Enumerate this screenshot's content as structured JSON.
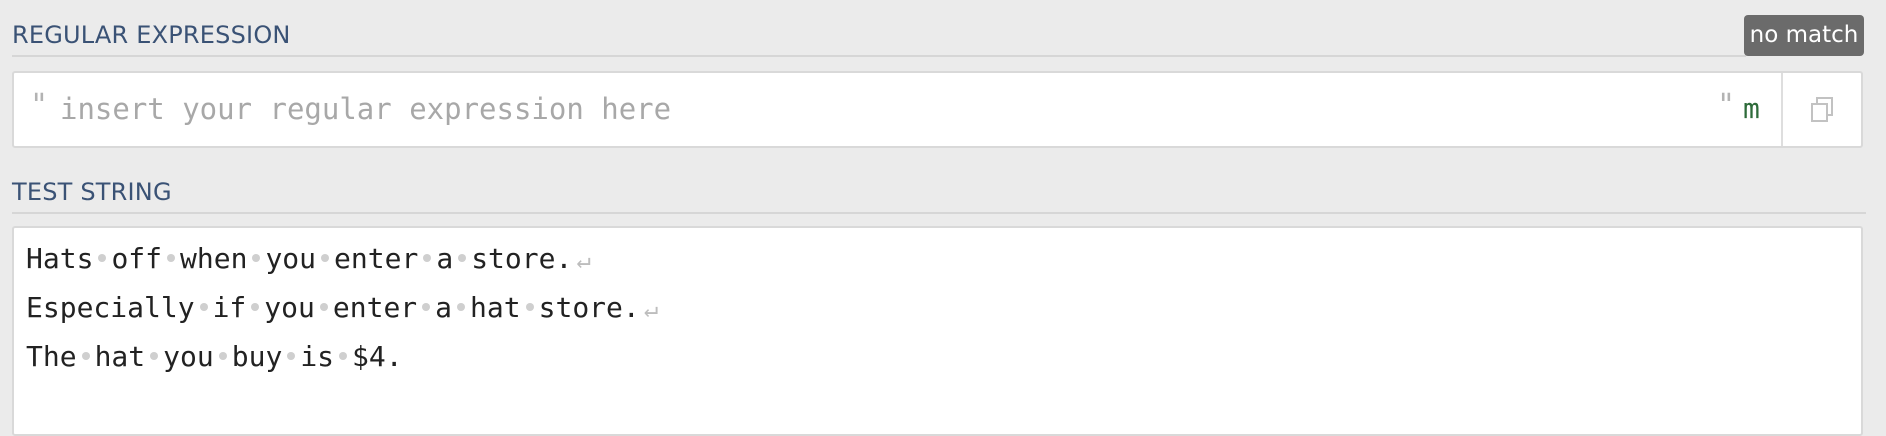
{
  "regex_section": {
    "title": "REGULAR EXPRESSION",
    "match_status": "no match",
    "open_delimiter": "\"",
    "close_delimiter": "\"",
    "placeholder": "insert your regular expression here",
    "value": "",
    "flags": "m",
    "copy_icon": "copy-icon"
  },
  "test_section": {
    "title": "TEST STRING",
    "lines": [
      {
        "words": [
          "Hats",
          "off",
          "when",
          "you",
          "enter",
          "a",
          "store."
        ],
        "newline": true
      },
      {
        "words": [
          "Especially",
          "if",
          "you",
          "enter",
          "a",
          "hat",
          "store."
        ],
        "newline": true
      },
      {
        "words": [
          "The",
          "hat",
          "you",
          "buy",
          "is",
          "$4."
        ],
        "newline": false
      }
    ],
    "newline_glyph": "↵"
  },
  "colors": {
    "section_title": "#3a5275",
    "badge_bg": "#6b6b6b",
    "flags": "#2e6b3a"
  }
}
